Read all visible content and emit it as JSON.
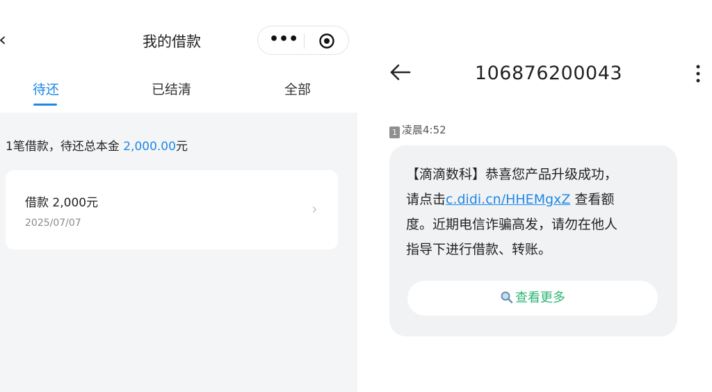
{
  "left": {
    "title": "我的借款",
    "capsule": {
      "more_icon": "more-dots-icon",
      "close_icon": "target-icon"
    },
    "tabs": [
      {
        "label": "待还",
        "active": true
      },
      {
        "label": "已结清",
        "active": false
      },
      {
        "label": "全部",
        "active": false
      }
    ],
    "summary": {
      "prefix": "1笔借款，待还总本金 ",
      "amount": "2,000.00",
      "suffix": "元"
    },
    "loan": {
      "title": "借款  2,000元",
      "date": "2025/07/07"
    }
  },
  "right": {
    "sender": "106876200043",
    "sim_label": "1",
    "time": "凌晨4:52",
    "message": {
      "line1": "【滴滴数科】恭喜您产品升级成功，",
      "line2_prefix": "请点击",
      "link": "c.didi.cn/HHEMgxZ",
      "line2_suffix": " 查看额",
      "line3": "度。近期电信诈骗高发，请勿在他人",
      "line4": "指导下进行借款、转账。"
    },
    "view_more": "查看更多"
  },
  "colors": {
    "accent": "#1e88e5",
    "green": "#2bb673"
  }
}
